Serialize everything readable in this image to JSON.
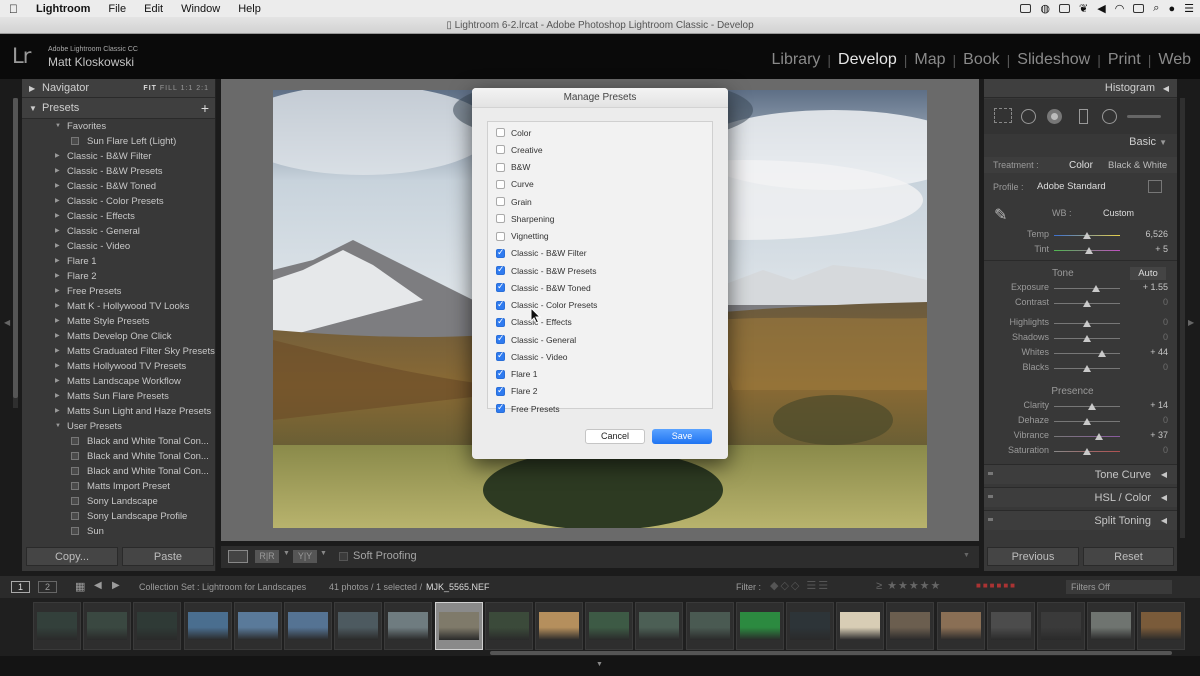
{
  "menubar": {
    "app": "Lightroom",
    "items": [
      "File",
      "Edit",
      "Window",
      "Help"
    ]
  },
  "titlebar": {
    "title": "Lightroom 6-2.lrcat - Adobe Photoshop Lightroom Classic - Develop"
  },
  "identity": {
    "logo": "Lr",
    "product": "Adobe Lightroom Classic CC",
    "user": "Matt Kloskowski"
  },
  "modules": [
    "Library",
    "Develop",
    "Map",
    "Book",
    "Slideshow",
    "Print",
    "Web"
  ],
  "active_module": "Develop",
  "left": {
    "navigator": {
      "title": "Navigator",
      "options": [
        "FIT",
        "FILL",
        "1:1",
        "2:1"
      ]
    },
    "presets_title": "Presets",
    "add_symbol": "+",
    "presets": [
      {
        "type": "folder",
        "label": "Favorites",
        "open": true
      },
      {
        "type": "item",
        "label": "Sun Flare Left (Light)"
      },
      {
        "type": "folder",
        "label": "Classic - B&W Filter"
      },
      {
        "type": "folder",
        "label": "Classic - B&W Presets"
      },
      {
        "type": "folder",
        "label": "Classic - B&W Toned"
      },
      {
        "type": "folder",
        "label": "Classic - Color Presets"
      },
      {
        "type": "folder",
        "label": "Classic - Effects"
      },
      {
        "type": "folder",
        "label": "Classic - General"
      },
      {
        "type": "folder",
        "label": "Classic - Video"
      },
      {
        "type": "folder",
        "label": "Flare 1"
      },
      {
        "type": "folder",
        "label": "Flare 2"
      },
      {
        "type": "folder",
        "label": "Free Presets"
      },
      {
        "type": "folder",
        "label": "Matt K - Hollywood TV Looks"
      },
      {
        "type": "folder",
        "label": "Matte Style Presets"
      },
      {
        "type": "folder",
        "label": "Matts Develop One Click"
      },
      {
        "type": "folder",
        "label": "Matts Graduated Filter Sky Presets"
      },
      {
        "type": "folder",
        "label": "Matts Hollywood TV Presets"
      },
      {
        "type": "folder",
        "label": "Matts Landscape Workflow"
      },
      {
        "type": "folder",
        "label": "Matts Sun Flare Presets"
      },
      {
        "type": "folder",
        "label": "Matts Sun Light and Haze Presets"
      },
      {
        "type": "folder",
        "label": "User Presets",
        "open": true
      },
      {
        "type": "item",
        "label": "Black and White Tonal Con..."
      },
      {
        "type": "item",
        "label": "Black and White Tonal Con..."
      },
      {
        "type": "item",
        "label": "Black and White Tonal Con..."
      },
      {
        "type": "item",
        "label": "Matts Import Preset"
      },
      {
        "type": "item",
        "label": "Sony Landscape"
      },
      {
        "type": "item",
        "label": "Sony Landscape Profile"
      },
      {
        "type": "item",
        "label": "Sun"
      }
    ],
    "copy_button": "Copy...",
    "paste_button": "Paste"
  },
  "toolbar": {
    "soft_proofing": "Soft Proofing",
    "rr": "R|R",
    "yy": "Y|Y"
  },
  "dialog": {
    "title": "Manage Presets",
    "items": [
      {
        "label": "Color",
        "checked": false
      },
      {
        "label": "Creative",
        "checked": false
      },
      {
        "label": "B&W",
        "checked": false
      },
      {
        "label": "Curve",
        "checked": false
      },
      {
        "label": "Grain",
        "checked": false
      },
      {
        "label": "Sharpening",
        "checked": false
      },
      {
        "label": "Vignetting",
        "checked": false
      },
      {
        "label": "Classic - B&W Filter",
        "checked": true
      },
      {
        "label": "Classic - B&W Presets",
        "checked": true
      },
      {
        "label": "Classic - B&W Toned",
        "checked": true
      },
      {
        "label": "Classic - Color Presets",
        "checked": true
      },
      {
        "label": "Classic - Effects",
        "checked": true
      },
      {
        "label": "Classic - General",
        "checked": true
      },
      {
        "label": "Classic - Video",
        "checked": true
      },
      {
        "label": "Flare 1",
        "checked": true
      },
      {
        "label": "Flare 2",
        "checked": true
      },
      {
        "label": "Free Presets",
        "checked": true
      }
    ],
    "cancel": "Cancel",
    "save": "Save"
  },
  "right": {
    "histogram": "Histogram",
    "basic": "Basic",
    "treatment_label": "Treatment :",
    "treatment_color": "Color",
    "treatment_bw": "Black & White",
    "profile_label": "Profile :",
    "profile_value": "Adobe Standard",
    "wb_label": "WB :",
    "wb_value": "Custom",
    "temp": {
      "label": "Temp",
      "value": "6,526",
      "pos": 0.5
    },
    "tint": {
      "label": "Tint",
      "value": "+ 5",
      "pos": 0.53
    },
    "tone": "Tone",
    "auto": "Auto",
    "sliders": [
      {
        "label": "Exposure",
        "value": "+ 1.55",
        "pos": 0.63,
        "dim": false
      },
      {
        "label": "Contrast",
        "value": "0",
        "pos": 0.5,
        "dim": true
      },
      {
        "label": "Highlights",
        "value": "0",
        "pos": 0.5,
        "dim": true
      },
      {
        "label": "Shadows",
        "value": "0",
        "pos": 0.5,
        "dim": true
      },
      {
        "label": "Whites",
        "value": "+ 44",
        "pos": 0.72,
        "dim": false
      },
      {
        "label": "Blacks",
        "value": "0",
        "pos": 0.5,
        "dim": true
      }
    ],
    "presence": "Presence",
    "presence_sliders": [
      {
        "label": "Clarity",
        "value": "+ 14",
        "pos": 0.57,
        "dim": false
      },
      {
        "label": "Dehaze",
        "value": "0",
        "pos": 0.5,
        "dim": true
      },
      {
        "label": "Vibrance",
        "value": "+ 37",
        "pos": 0.68,
        "dim": false
      },
      {
        "label": "Saturation",
        "value": "0",
        "pos": 0.5,
        "dim": true
      }
    ],
    "tone_curve": "Tone Curve",
    "hsl": "HSL / Color",
    "split_toning": "Split Toning",
    "previous_button": "Previous",
    "reset_button": "Reset"
  },
  "filmbar": {
    "page1": "1",
    "page2": "2",
    "collection": "Collection Set : Lightroom for Landscapes",
    "count": "41 photos / 1 selected /",
    "filename": "MJK_5565.NEF",
    "filter_label": "Filter :",
    "filters_off": "Filters Off"
  },
  "filmstrip_colors": [
    "#33403b",
    "#3a4841",
    "#2f3a36",
    "#4a6e8f",
    "#5a7a9a",
    "#557393",
    "#4d5a60",
    "#6f7c80",
    "#7f7a6a",
    "#3b4a3a",
    "#b58f5d",
    "#3d5a45",
    "#4c5f55",
    "#4a5a52",
    "#2c8a40",
    "#2d3438",
    "#d8cdb5",
    "#6b5e4f",
    "#8a6f55",
    "#4c4c4c",
    "#3a3a3a",
    "#6f7470",
    "#7a5b3a"
  ],
  "colors": {
    "accent": "#2f7bf0"
  }
}
